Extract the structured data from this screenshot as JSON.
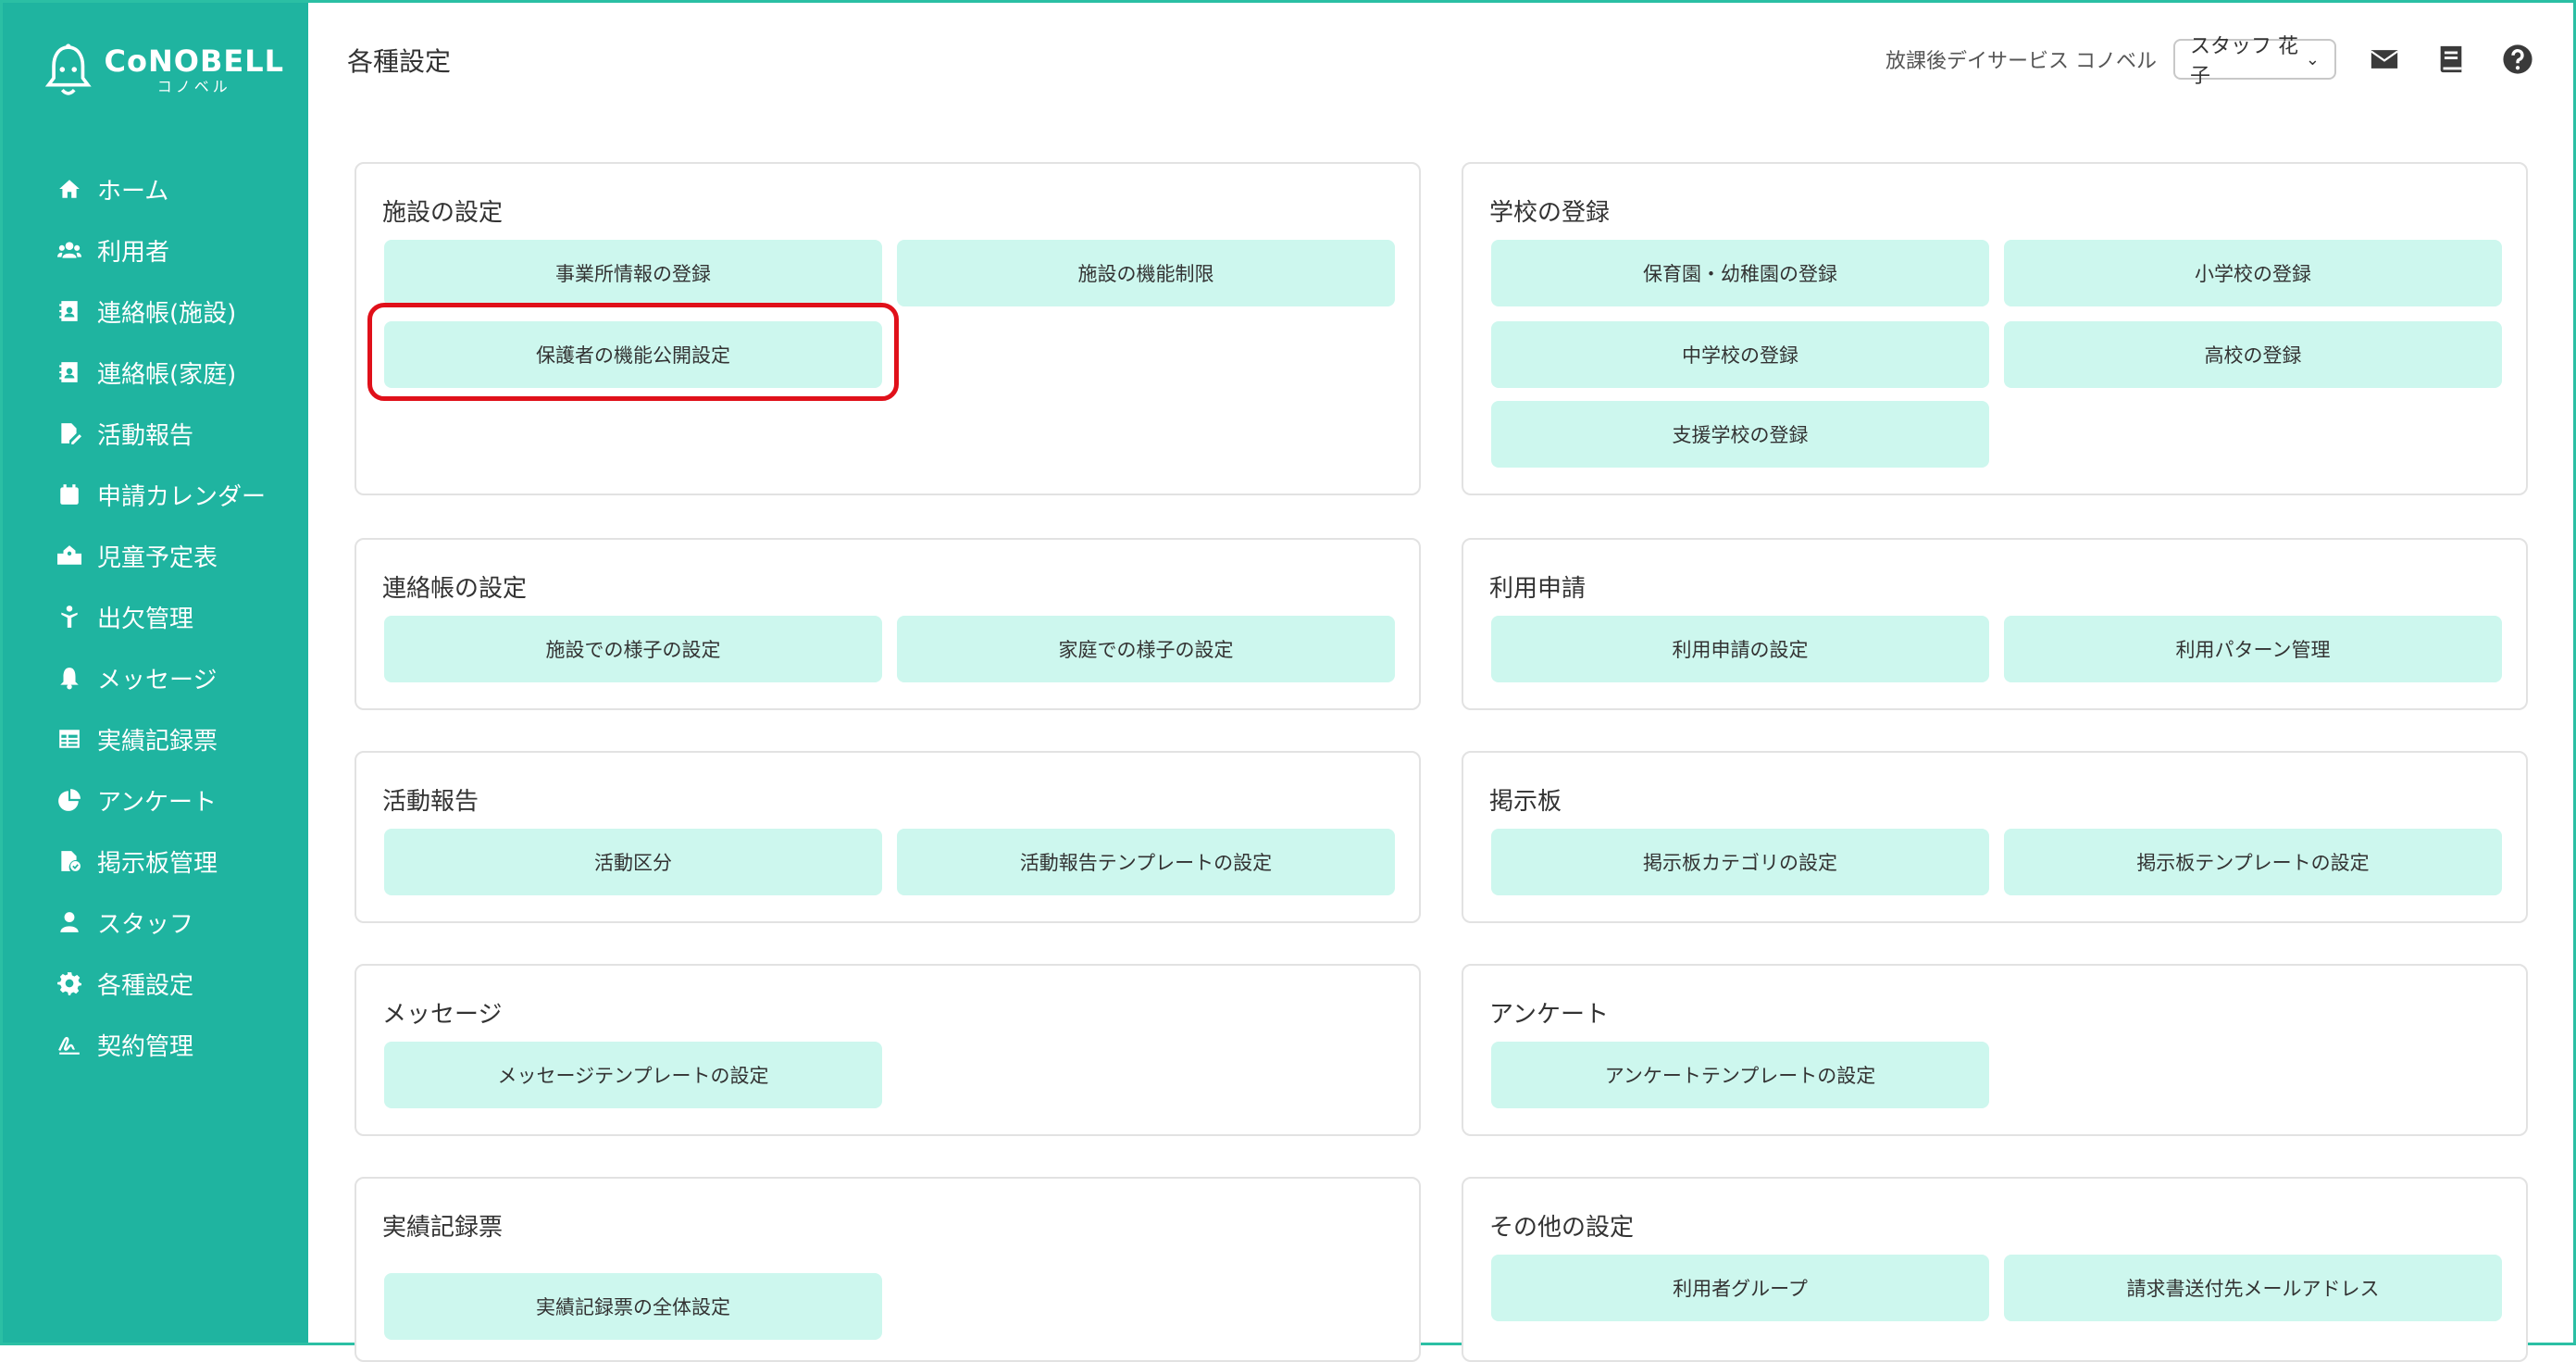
{
  "brand": {
    "name": "CoNOBELL",
    "sub": "コノベル"
  },
  "sidebar": {
    "items": [
      {
        "label": "ホーム",
        "icon": "home-icon"
      },
      {
        "label": "利用者",
        "icon": "users-icon"
      },
      {
        "label": "連絡帳(施設)",
        "icon": "contact-book-icon"
      },
      {
        "label": "連絡帳(家庭)",
        "icon": "contact-book-icon"
      },
      {
        "label": "活動報告",
        "icon": "file-pen-icon"
      },
      {
        "label": "申請カレンダー",
        "icon": "calendar-icon"
      },
      {
        "label": "児童予定表",
        "icon": "school-icon"
      },
      {
        "label": "出欠管理",
        "icon": "person-icon"
      },
      {
        "label": "メッセージ",
        "icon": "bell-icon"
      },
      {
        "label": "実績記録票",
        "icon": "table-icon"
      },
      {
        "label": "アンケート",
        "icon": "pie-chart-icon"
      },
      {
        "label": "掲示板管理",
        "icon": "file-check-icon"
      },
      {
        "label": "スタッフ",
        "icon": "user-icon"
      },
      {
        "label": "各種設定",
        "icon": "gear-icon"
      },
      {
        "label": "契約管理",
        "icon": "signature-icon"
      }
    ]
  },
  "header": {
    "title": "各種設定",
    "facility": "放課後デイサービス コノベル",
    "staff": "スタッフ 花子"
  },
  "cards": {
    "facility": {
      "title": "施設の設定",
      "buttons": [
        "事業所情報の登録",
        "施設の機能制限",
        "保護者の機能公開設定"
      ]
    },
    "school": {
      "title": "学校の登録",
      "buttons": [
        "保育園・幼稚園の登録",
        "小学校の登録",
        "中学校の登録",
        "高校の登録",
        "支援学校の登録"
      ]
    },
    "renraku": {
      "title": "連絡帳の設定",
      "buttons": [
        "施設での様子の設定",
        "家庭での様子の設定"
      ]
    },
    "riyo": {
      "title": "利用申請",
      "buttons": [
        "利用申請の設定",
        "利用パターン管理"
      ]
    },
    "katsudo": {
      "title": "活動報告",
      "buttons": [
        "活動区分",
        "活動報告テンプレートの設定"
      ]
    },
    "keiji": {
      "title": "掲示板",
      "buttons": [
        "掲示板カテゴリの設定",
        "掲示板テンプレートの設定"
      ]
    },
    "message": {
      "title": "メッセージ",
      "buttons": [
        "メッセージテンプレートの設定"
      ]
    },
    "enquete": {
      "title": "アンケート",
      "buttons": [
        "アンケートテンプレートの設定"
      ]
    },
    "jisseki": {
      "title": "実績記録票",
      "buttons": [
        "実績記録票の全体設定"
      ]
    },
    "other": {
      "title": "その他の設定",
      "buttons": [
        "利用者グループ",
        "請求書送付先メールアドレス"
      ]
    }
  },
  "colors": {
    "sidebar": "#1fb4a0",
    "button": "#cdf7ee",
    "highlight": "#e0101a"
  }
}
